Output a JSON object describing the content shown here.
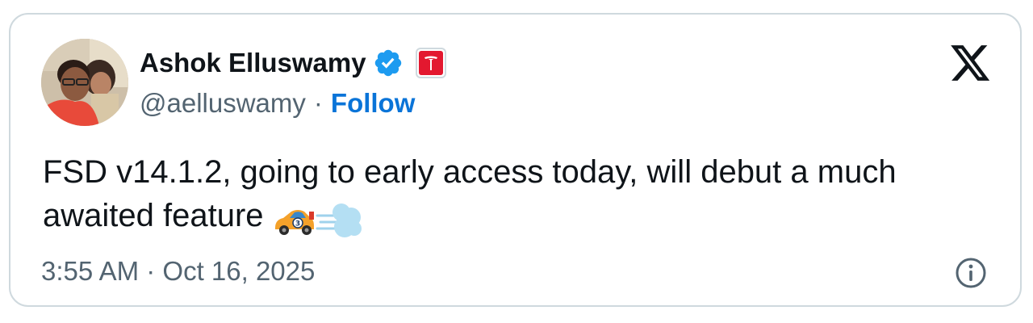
{
  "author": {
    "display_name": "Ashok Elluswamy",
    "handle": "@aelluswamy",
    "separator": "·",
    "follow_label": "Follow",
    "verified_color": "#1d9bf0",
    "affiliate_badge_color": "#e3182f"
  },
  "tweet": {
    "text": "FSD v14.1.2, going to early access today, will debut a much awaited feature",
    "emojis": [
      "race-car-emoji",
      "dashing-away-emoji"
    ],
    "timestamp": "3:55 AM · Oct 16, 2025"
  },
  "icons": {
    "brand": "x-logo-icon",
    "info": "info-icon"
  },
  "colors": {
    "follow_link": "#0a74d8",
    "secondary_text": "#536471",
    "border": "#cfd9de"
  }
}
